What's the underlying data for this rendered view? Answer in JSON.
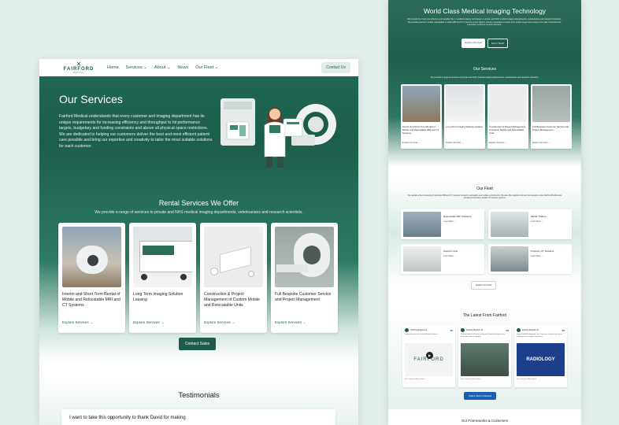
{
  "colors": {
    "brand": "#1d5c4a",
    "background": "#e3efeb",
    "linkedin": "#0a66c2"
  },
  "nav": {
    "logo_word": "FAIRFORD",
    "logo_sub": "MEDICAL",
    "items": [
      "Home",
      "Services",
      "About",
      "News",
      "Our Fleet"
    ],
    "contact": "Contact Us"
  },
  "hero": {
    "title": "Our Services",
    "body": "Fairford Medical understands that every customer and imaging department has its unique requirements for increasing efficiency and throughput to hit performance targets, budgetary and funding constraints and above all physical space restrictions. We are dedicated to helping our customers deliver the best and most efficient patient care possible and bring our expertise and creativity to tailor the most suitable solutions for each customer."
  },
  "rental": {
    "title": "Rental Services We Offer",
    "lead": "We provide a range of services to private and NHS medical imaging departments, veterinarians and research scientists.",
    "cards": [
      {
        "title": "Interim and Short Term Rental of Mobile and Relocatable MRI and CT Systems",
        "link": "Explore Services"
      },
      {
        "title": "Long Term Imaging Solution Leasing",
        "link": "Explore Services"
      },
      {
        "title": "Construction & Project Management of Custom Mobile and Relocatable Units",
        "link": "Explore Services"
      },
      {
        "title": "Full Bespoke Customer Service and Project Management",
        "link": "Explore Services"
      }
    ],
    "cta": "Contact Sales"
  },
  "testimonials": {
    "title": "Testimonials",
    "quote": "I want to take this opportunity to thank David for making"
  },
  "home": {
    "hero_title": "World Class Medical Imaging Technology",
    "hero_body": "We provide the most cost effective and suitable Tier 1 medical imaging technology to private and NHS medical imaging departments, veterinarians and research scientists. We provide premium mobile, relocatable or static MRI and CT scanners at the highest industry standards on short term rental, longer term lease or for sale combined with exemplary customer support services.",
    "btn_fleet": "Explore Our Fleet",
    "btn_touch": "Get in Touch",
    "services_title": "Our Services",
    "services_lead": "We provide a range of services to private and NHS medical imaging departments, veterinarians and research scientists.",
    "services": [
      {
        "title": "Interim and Short Term Rental of Mobile and Relocatable MRI and CT Systems",
        "link": "Explore Services"
      },
      {
        "title": "Long Term Imaging Solution Leasing",
        "link": "Explore Services"
      },
      {
        "title": "Construction & Project Management of Custom Mobile and Relocatable Units",
        "link": "Explore Services"
      },
      {
        "title": "Full Bespoke Customer Service and Project Management",
        "link": "Explore Services"
      }
    ],
    "fleet_title": "Our Fleet",
    "fleet_lead": "We operate a fleet consisting of premium MRI and CT systems housed in relocatable and mobile environments. We also offer support units such as reception units. Fairford Medical also provides proprietary modular CT scanner systems.",
    "fleet": [
      {
        "title": "Relocatable MRI Solutions",
        "link": "Learn More"
      },
      {
        "title": "Mobile Trailers",
        "link": "Learn More"
      },
      {
        "title": "Support Units",
        "link": "Learn More"
      },
      {
        "title": "Propriety CT Scanbus",
        "link": "Learn More"
      }
    ],
    "fleet_btn": "Explore Our Fleet",
    "latest_title": "The Latest From Fairford",
    "posts": [
      {
        "name": "Fairford Medical Ltd",
        "text": "Introducing our new Fairford Medical website!",
        "img_label": "FAIRFORD"
      },
      {
        "name": "Fairford Medical Ltd",
        "text": "Fairford Medical will return to Bevan & Hope Birmingham this week with a fleet on display.",
        "img_label": ""
      },
      {
        "name": "Fairford Medical Ltd",
        "text": "Happy World Radiography Day! Today we celebrate the role of radiographers in modern healthcare.",
        "img_label": "RADIOLOGY"
      }
    ],
    "post_actions": "Like   Comment   Share   Send",
    "follow": "Follow Fairford Medical",
    "frameworks": "Our Frameworks & Customers"
  }
}
